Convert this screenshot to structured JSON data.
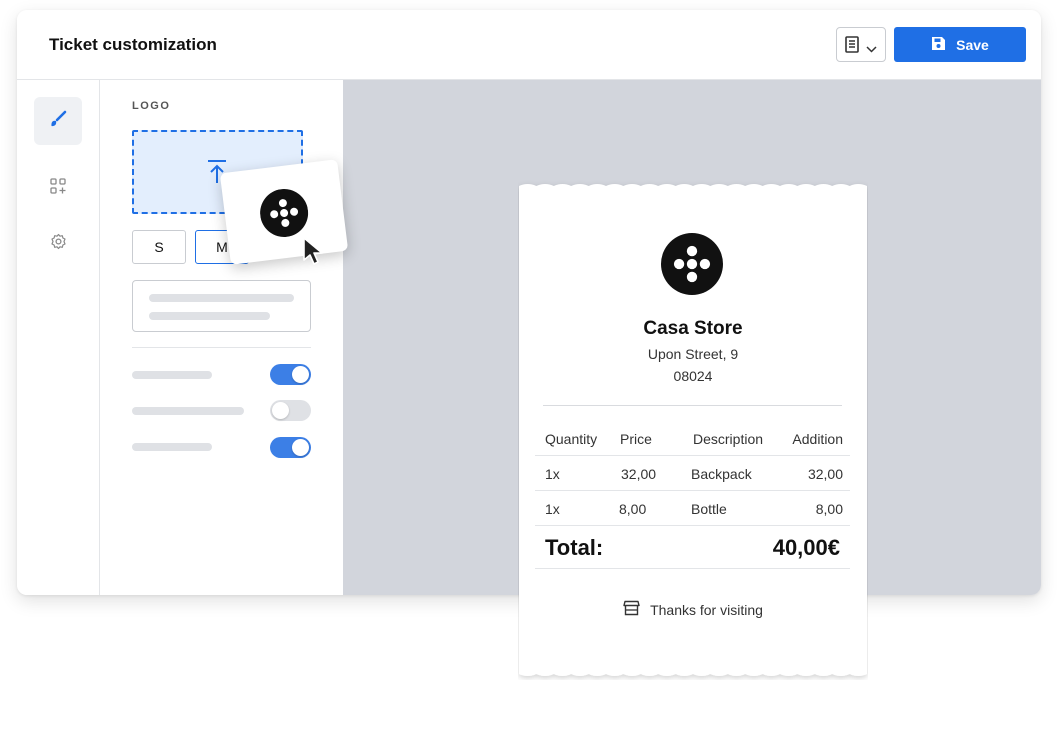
{
  "header": {
    "title": "Ticket customization",
    "save_label": "Save"
  },
  "colors": {
    "accent": "#1f6fe5",
    "preview_bg": "#d2d5dc",
    "toggle_on": "#3c7fe6",
    "toggle_off": "#dfe1e5"
  },
  "rail": {
    "items": [
      {
        "name": "appearance",
        "icon": "paintbrush-icon",
        "active": true
      },
      {
        "name": "widgets",
        "icon": "add-grid-icon",
        "active": false
      },
      {
        "name": "settings",
        "icon": "gear-icon",
        "active": false
      }
    ]
  },
  "panel": {
    "logo_label": "LOGO",
    "sizes": [
      "S",
      "M"
    ],
    "selected_size": "M",
    "toggles": [
      true,
      false,
      true
    ]
  },
  "receipt": {
    "store_name": "Casa Store",
    "address": "Upon Street, 9",
    "postal_code": "08024",
    "columns": [
      "Quantity",
      "Price",
      "Description",
      "Addition"
    ],
    "rows": [
      {
        "qty": "1x",
        "price": "32,00",
        "desc": "Backpack",
        "add": "32,00"
      },
      {
        "qty": "1x",
        "price": "8,00",
        "desc": "Bottle",
        "add": "8,00"
      }
    ],
    "total_label": "Total:",
    "total_value": "40,00€",
    "footer": "Thanks for visiting"
  }
}
